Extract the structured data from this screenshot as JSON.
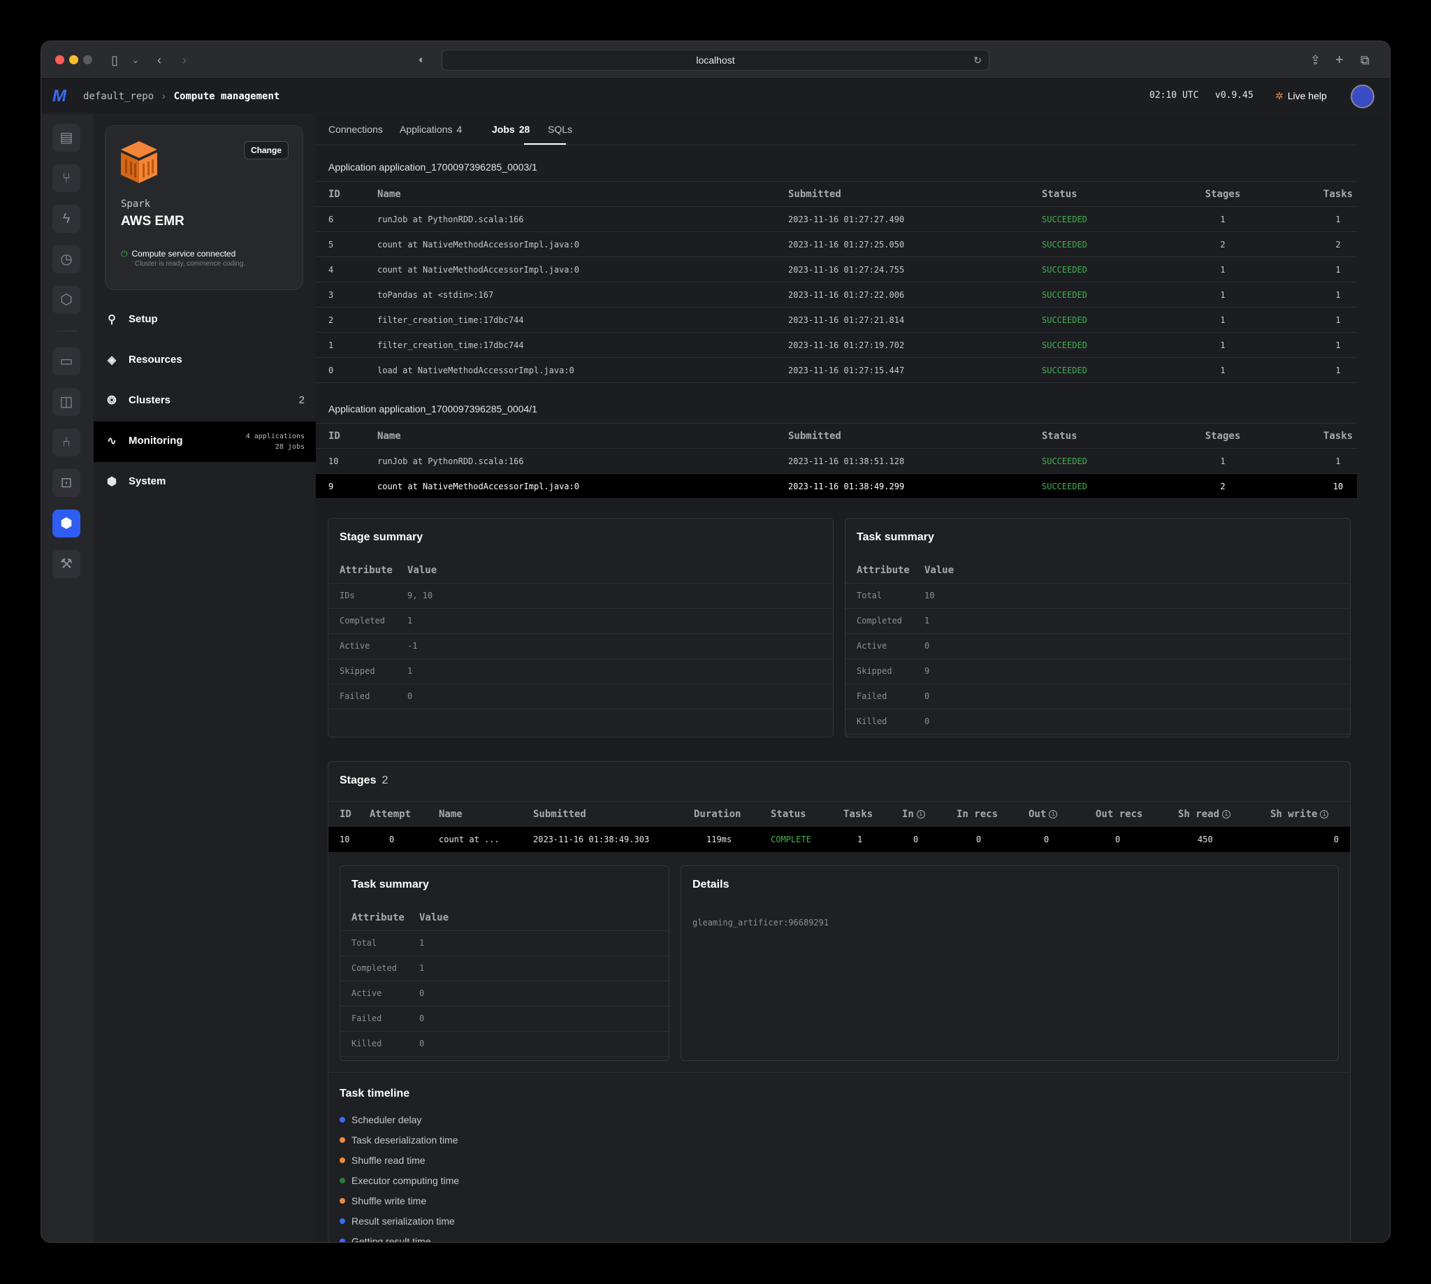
{
  "browser": {
    "url": "localhost"
  },
  "header": {
    "logo": "M",
    "repo": "default_repo",
    "page": "Compute management",
    "time": "02:10 UTC",
    "version": "v0.9.45",
    "live_help": "Live help"
  },
  "compute_card": {
    "change_label": "Change",
    "engine": "Spark",
    "provider": "AWS EMR",
    "status": "Compute service connected",
    "status_sub": "Cluster is ready, commence coding."
  },
  "nav": {
    "setup": "Setup",
    "resources": "Resources",
    "clusters": "Clusters",
    "clusters_count": "2",
    "monitoring": "Monitoring",
    "monitoring_apps": "4 applications",
    "monitoring_jobs": "28 jobs",
    "system": "System"
  },
  "tabs": {
    "connections": "Connections",
    "applications": "Applications",
    "applications_count": "4",
    "jobs": "Jobs",
    "jobs_count": "28",
    "sqls": "SQLs"
  },
  "job_columns": {
    "id": "ID",
    "name": "Name",
    "submitted": "Submitted",
    "status": "Status",
    "stages": "Stages",
    "tasks": "Tasks"
  },
  "applications": [
    {
      "title": "Application application_1700097396285_0003/1",
      "jobs": [
        {
          "id": "6",
          "name": "runJob at PythonRDD.scala:166",
          "submitted": "2023-11-16 01:27:27.490",
          "status": "SUCCEEDED",
          "stages": "1",
          "tasks": "1"
        },
        {
          "id": "5",
          "name": "count at NativeMethodAccessorImpl.java:0",
          "submitted": "2023-11-16 01:27:25.050",
          "status": "SUCCEEDED",
          "stages": "2",
          "tasks": "2"
        },
        {
          "id": "4",
          "name": "count at NativeMethodAccessorImpl.java:0",
          "submitted": "2023-11-16 01:27:24.755",
          "status": "SUCCEEDED",
          "stages": "1",
          "tasks": "1"
        },
        {
          "id": "3",
          "name": "toPandas at <stdin>:167",
          "submitted": "2023-11-16 01:27:22.006",
          "status": "SUCCEEDED",
          "stages": "1",
          "tasks": "1"
        },
        {
          "id": "2",
          "name": "filter_creation_time:17dbc744",
          "submitted": "2023-11-16 01:27:21.814",
          "status": "SUCCEEDED",
          "stages": "1",
          "tasks": "1"
        },
        {
          "id": "1",
          "name": "filter_creation_time:17dbc744",
          "submitted": "2023-11-16 01:27:19.702",
          "status": "SUCCEEDED",
          "stages": "1",
          "tasks": "1"
        },
        {
          "id": "0",
          "name": "load at NativeMethodAccessorImpl.java:0",
          "submitted": "2023-11-16 01:27:15.447",
          "status": "SUCCEEDED",
          "stages": "1",
          "tasks": "1"
        }
      ]
    },
    {
      "title": "Application application_1700097396285_0004/1",
      "jobs": [
        {
          "id": "10",
          "name": "runJob at PythonRDD.scala:166",
          "submitted": "2023-11-16 01:38:51.128",
          "status": "SUCCEEDED",
          "stages": "1",
          "tasks": "1"
        },
        {
          "id": "9",
          "name": "count at NativeMethodAccessorImpl.java:0",
          "submitted": "2023-11-16 01:38:49.299",
          "status": "SUCCEEDED",
          "stages": "2",
          "tasks": "10"
        }
      ]
    }
  ],
  "kv_columns": {
    "attribute": "Attribute",
    "value": "Value"
  },
  "stage_summary": {
    "title": "Stage summary",
    "rows": [
      {
        "k": "IDs",
        "v": "9, 10"
      },
      {
        "k": "Completed",
        "v": "1"
      },
      {
        "k": "Active",
        "v": "-1"
      },
      {
        "k": "Skipped",
        "v": "1"
      },
      {
        "k": "Failed",
        "v": "0"
      }
    ]
  },
  "task_summary": {
    "title": "Task summary",
    "rows": [
      {
        "k": "Total",
        "v": "10"
      },
      {
        "k": "Completed",
        "v": "1"
      },
      {
        "k": "Active",
        "v": "0"
      },
      {
        "k": "Skipped",
        "v": "9"
      },
      {
        "k": "Failed",
        "v": "0"
      },
      {
        "k": "Killed",
        "v": "0"
      }
    ]
  },
  "stages": {
    "title": "Stages",
    "count": "2",
    "columns": {
      "id": "ID",
      "attempt": "Attempt",
      "name": "Name",
      "submitted": "Submitted",
      "duration": "Duration",
      "status": "Status",
      "tasks": "Tasks",
      "in": "In",
      "in_recs": "In recs",
      "out": "Out",
      "out_recs": "Out recs",
      "sh_read": "Sh read",
      "sh_write": "Sh write"
    },
    "row": {
      "id": "10",
      "attempt": "0",
      "name": "count at ...",
      "submitted": "2023-11-16 01:38:49.303",
      "duration": "119ms",
      "status": "COMPLETE",
      "tasks": "1",
      "in": "0",
      "in_recs": "0",
      "out": "0",
      "out_recs": "0",
      "sh_read": "450",
      "sh_write": "0"
    }
  },
  "stage_task_summary": {
    "title": "Task summary",
    "rows": [
      {
        "k": "Total",
        "v": "1"
      },
      {
        "k": "Completed",
        "v": "1"
      },
      {
        "k": "Active",
        "v": "0"
      },
      {
        "k": "Failed",
        "v": "0"
      },
      {
        "k": "Killed",
        "v": "0"
      }
    ]
  },
  "details": {
    "title": "Details",
    "value": "gleaming_artificer:96689291"
  },
  "task_timeline": {
    "title": "Task timeline",
    "items": [
      {
        "label": "Scheduler delay",
        "color": "#3b6cf5"
      },
      {
        "label": "Task deserialization time",
        "color": "#f08a3c"
      },
      {
        "label": "Shuffle read time",
        "color": "#f08a3c"
      },
      {
        "label": "Executor computing time",
        "color": "#2f7d3a"
      },
      {
        "label": "Shuffle write time",
        "color": "#f08a3c"
      },
      {
        "label": "Result serialization time",
        "color": "#3b6cf5"
      },
      {
        "label": "Getting result time",
        "color": "#3b6cf5"
      }
    ]
  }
}
